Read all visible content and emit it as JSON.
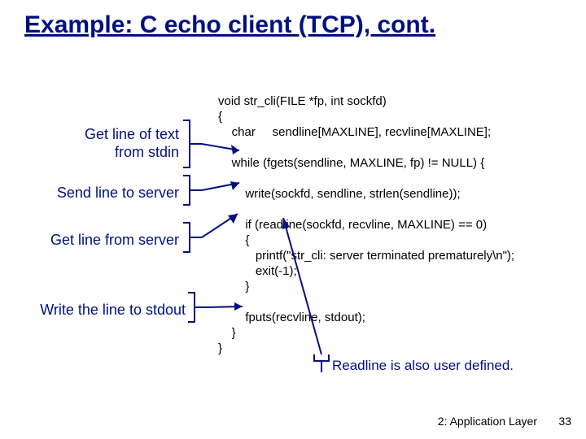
{
  "title": "Example: C echo client (TCP), cont.",
  "labels": {
    "get_stdin_line1": "Get line of text",
    "get_stdin_line2": "from stdin",
    "send_server": "Send line to server",
    "get_server": "Get line from server",
    "write_stdout": "Write the line to stdout"
  },
  "code_text": "void str_cli(FILE *fp, int sockfd)\n{\n    char     sendline[MAXLINE], recvline[MAXLINE];\n\n    while (fgets(sendline, MAXLINE, fp) != NULL) {\n\n        write(sockfd, sendline, strlen(sendline));\n\n        if (readline(sockfd, recvline, MAXLINE) == 0)\n        {\n           printf(\"str_cli: server terminated prematurely\\n\");\n           exit(-1);\n        }\n\n        fputs(recvline, stdout);\n    }\n}",
  "footnote": "Readline is also user defined.",
  "footer": {
    "chapter": "2: Application Layer",
    "page": "33"
  }
}
